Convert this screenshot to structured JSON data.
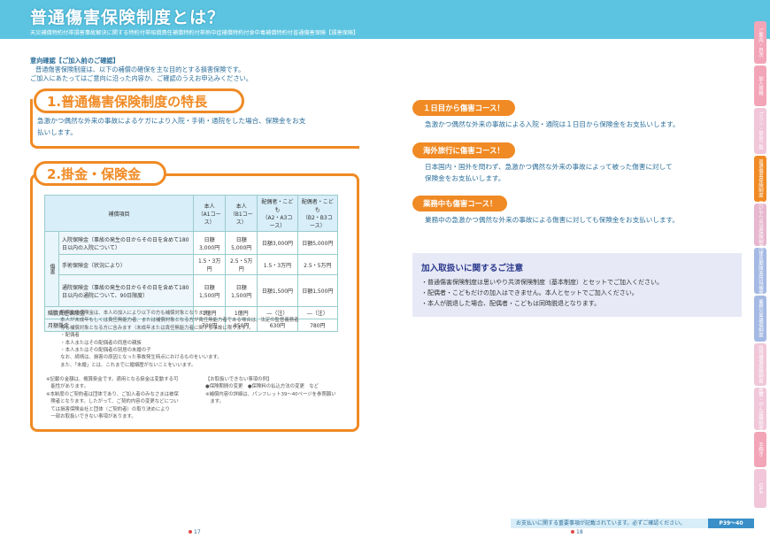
{
  "header": {
    "title": "普通傷害保険制度とは？",
    "subtitle": "天災補償特約付帯損害事故解決に関する特約付帯賠償責任補償特約付帯熱中症補償特約付食中毒補償特約付普通傷害保険【損害保険】"
  },
  "intro": {
    "line1": "意向確認【ご加入前のご確認】",
    "line2": "普通傷害保険制度は、以下の補償の確保を主な目的とする損害保険です。",
    "line3": "ご加入にあたってはご意向に沿った内容か、ご確認のうえお申込みください。"
  },
  "section1": {
    "heading": "1.普通傷害保険制度の特長",
    "line1": "急激かつ偶然な外来の事故によるケガにより入院・手術・通院をした場合、保険金をお支",
    "line2": "払いします。"
  },
  "section2": {
    "heading": "2.掛金・保険金",
    "table": {
      "header": [
        "補償項目",
        "本人\n（A1コース）",
        "本人\n（B1コース）",
        "配偶者・こども\n（A2・A3コース）",
        "配偶者・こども\n（B2・B3コース）"
      ],
      "group_label": "傷害",
      "rows": [
        {
          "label": "入院保険金（事故の発生の日からその日を含めて180日以内の入院について）",
          "values": [
            "日額3,000円",
            "日額5,000円",
            "日額3,000円",
            "日額5,000円"
          ]
        },
        {
          "label": "手術保険金（状況により）",
          "values": [
            "1.5・3万円",
            "2.5・5万円",
            "1.5・3万円",
            "2.5・5万円"
          ]
        },
        {
          "label": "通院保険金（事故の発生の日からその日を含めて180日以内の通院について、90日限度）",
          "values": [
            "日額1,500円",
            "日額1,500円",
            "日額1,500円",
            "日額1,500円"
          ]
        }
      ],
      "liability": {
        "label": "賠償責任保険金",
        "values": [
          "1億円",
          "1億円",
          "―（注）",
          "―（注）"
        ]
      },
      "premium": {
        "label": "月額掛金",
        "values": [
          "700円",
          "850円",
          "630円",
          "780円"
        ]
      }
    },
    "note_main": "（注）賠償責任保険金は、本人の加入により以下の方も補償対象となります。\n　　　本人が未成年もしくは責任無能力者、または補償対象となる方が責任無能力者である場合は、法定の監督義務者\n　　　等も補償対象となる方に含みます（未成年または責任無能力者に関する事故に限ります）。\n　　　・配偶者\n　　　・本人またはその配偶者の同居の親族\n　　　・本人またはその配偶者の別居の未婚の子\n　　　なお、続柄は、損害の原因となった事故発生時点におけるものをいいます。\n　　　また、「未婚」とは、これまでに婚姻歴がないことをいいます。",
    "note_left": "※記載の金額は、概算掛金です。適用となる掛金は変動する可\n　能性があります。\n※本制度のご契約者は団体であり、ご加入者のみなさまは被保\n　険者となります。したがって、ご契約内容の変更などについ\n　ては損害保険会社と団体（ご契約者）の取り決めにより\n　一部お取扱いできない事項があります。",
    "note_right": "【お取扱いできない事項の例】\n●保険期間の変更　●保険料の払込方法の変更　など\n※補償内容の詳細は、パンフレット39～40ページを参照願い\n　ます。"
  },
  "right": {
    "items": [
      {
        "label": "１日目から傷害コース！",
        "text": "急激かつ偶然な外来の事故による入院・通院は１日目から保険金をお支払いします。"
      },
      {
        "label": "海外旅行に傷害コース！",
        "text": "日本国内・国外を問わず、急激かつ偶然な外来の事故によって被った傷害に対して\n保険金をお支払いします。"
      },
      {
        "label": "業務中も傷害コース！",
        "text": "業務中の急激かつ偶然な外来の事故による傷害に対しても保険金をお支払いします。"
      }
    ],
    "caution": {
      "heading": "加入取扱いに関するご注意",
      "items": [
        "・普通傷害保険制度は思いやり共済保険制度（基本制度）とセットでご加入ください。",
        "・配偶者・こどもだけの加入はできません。本人とセットでご加入ください。",
        "・本人が脱退した場合、配偶者・こどもは同時脱退となります。"
      ]
    }
  },
  "sidebar": {
    "tabs": [
      {
        "label": "ご案内・目次",
        "color": "#f3a5b8"
      },
      {
        "label": "加入資格",
        "color": "#f3a5b8"
      },
      {
        "label": "プラン・掛金一覧",
        "color": "#f0c6d8"
      },
      {
        "label": "普通傷害保険制度",
        "color": "#f08a24"
      },
      {
        "label": "思いやり共済保険制度",
        "color": "#e6b7cf"
      },
      {
        "label": "団体長期障害所得補償",
        "color": "#a4b9e3"
      },
      {
        "label": "業務災害補償制度",
        "color": "#a4b9e3"
      },
      {
        "label": "所得補償保険制度",
        "color": "#f0c6d8"
      },
      {
        "label": "医療・がん保険制度",
        "color": "#f0c6d8"
      },
      {
        "label": "手続き",
        "color": "#f3a5b8"
      },
      {
        "label": "Q&A",
        "color": "#f0c6d8"
      }
    ]
  },
  "footer": {
    "text": "お支払いに関する重要事項が記載されています。必ずご確認ください。",
    "page_ref": "P39～40",
    "page_left": "17",
    "page_right": "18"
  }
}
